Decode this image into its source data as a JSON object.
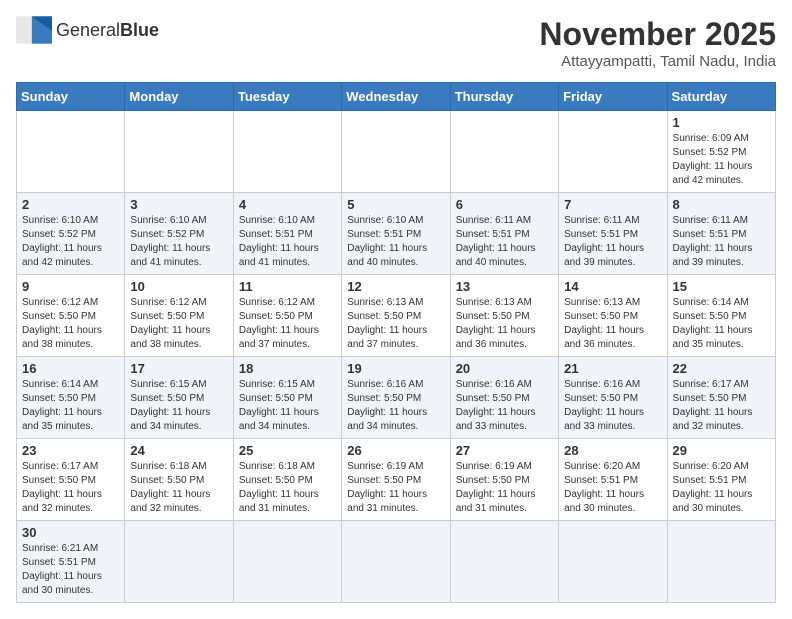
{
  "logo": {
    "text_general": "General",
    "text_blue": "Blue"
  },
  "title": "November 2025",
  "location": "Attayyampatti, Tamil Nadu, India",
  "weekdays": [
    "Sunday",
    "Monday",
    "Tuesday",
    "Wednesday",
    "Thursday",
    "Friday",
    "Saturday"
  ],
  "weeks": [
    [
      null,
      null,
      null,
      null,
      null,
      null,
      {
        "day": "1",
        "sunrise": "6:09 AM",
        "sunset": "5:52 PM",
        "daylight": "11 hours and 42 minutes."
      }
    ],
    [
      {
        "day": "2",
        "sunrise": "6:10 AM",
        "sunset": "5:52 PM",
        "daylight": "11 hours and 42 minutes."
      },
      {
        "day": "3",
        "sunrise": "6:10 AM",
        "sunset": "5:52 PM",
        "daylight": "11 hours and 41 minutes."
      },
      {
        "day": "4",
        "sunrise": "6:10 AM",
        "sunset": "5:51 PM",
        "daylight": "11 hours and 41 minutes."
      },
      {
        "day": "5",
        "sunrise": "6:10 AM",
        "sunset": "5:51 PM",
        "daylight": "11 hours and 40 minutes."
      },
      {
        "day": "6",
        "sunrise": "6:11 AM",
        "sunset": "5:51 PM",
        "daylight": "11 hours and 40 minutes."
      },
      {
        "day": "7",
        "sunrise": "6:11 AM",
        "sunset": "5:51 PM",
        "daylight": "11 hours and 39 minutes."
      },
      {
        "day": "8",
        "sunrise": "6:11 AM",
        "sunset": "5:51 PM",
        "daylight": "11 hours and 39 minutes."
      }
    ],
    [
      {
        "day": "9",
        "sunrise": "6:12 AM",
        "sunset": "5:50 PM",
        "daylight": "11 hours and 38 minutes."
      },
      {
        "day": "10",
        "sunrise": "6:12 AM",
        "sunset": "5:50 PM",
        "daylight": "11 hours and 38 minutes."
      },
      {
        "day": "11",
        "sunrise": "6:12 AM",
        "sunset": "5:50 PM",
        "daylight": "11 hours and 37 minutes."
      },
      {
        "day": "12",
        "sunrise": "6:13 AM",
        "sunset": "5:50 PM",
        "daylight": "11 hours and 37 minutes."
      },
      {
        "day": "13",
        "sunrise": "6:13 AM",
        "sunset": "5:50 PM",
        "daylight": "11 hours and 36 minutes."
      },
      {
        "day": "14",
        "sunrise": "6:13 AM",
        "sunset": "5:50 PM",
        "daylight": "11 hours and 36 minutes."
      },
      {
        "day": "15",
        "sunrise": "6:14 AM",
        "sunset": "5:50 PM",
        "daylight": "11 hours and 35 minutes."
      }
    ],
    [
      {
        "day": "16",
        "sunrise": "6:14 AM",
        "sunset": "5:50 PM",
        "daylight": "11 hours and 35 minutes."
      },
      {
        "day": "17",
        "sunrise": "6:15 AM",
        "sunset": "5:50 PM",
        "daylight": "11 hours and 34 minutes."
      },
      {
        "day": "18",
        "sunrise": "6:15 AM",
        "sunset": "5:50 PM",
        "daylight": "11 hours and 34 minutes."
      },
      {
        "day": "19",
        "sunrise": "6:16 AM",
        "sunset": "5:50 PM",
        "daylight": "11 hours and 34 minutes."
      },
      {
        "day": "20",
        "sunrise": "6:16 AM",
        "sunset": "5:50 PM",
        "daylight": "11 hours and 33 minutes."
      },
      {
        "day": "21",
        "sunrise": "6:16 AM",
        "sunset": "5:50 PM",
        "daylight": "11 hours and 33 minutes."
      },
      {
        "day": "22",
        "sunrise": "6:17 AM",
        "sunset": "5:50 PM",
        "daylight": "11 hours and 32 minutes."
      }
    ],
    [
      {
        "day": "23",
        "sunrise": "6:17 AM",
        "sunset": "5:50 PM",
        "daylight": "11 hours and 32 minutes."
      },
      {
        "day": "24",
        "sunrise": "6:18 AM",
        "sunset": "5:50 PM",
        "daylight": "11 hours and 32 minutes."
      },
      {
        "day": "25",
        "sunrise": "6:18 AM",
        "sunset": "5:50 PM",
        "daylight": "11 hours and 31 minutes."
      },
      {
        "day": "26",
        "sunrise": "6:19 AM",
        "sunset": "5:50 PM",
        "daylight": "11 hours and 31 minutes."
      },
      {
        "day": "27",
        "sunrise": "6:19 AM",
        "sunset": "5:50 PM",
        "daylight": "11 hours and 31 minutes."
      },
      {
        "day": "28",
        "sunrise": "6:20 AM",
        "sunset": "5:51 PM",
        "daylight": "11 hours and 30 minutes."
      },
      {
        "day": "29",
        "sunrise": "6:20 AM",
        "sunset": "5:51 PM",
        "daylight": "11 hours and 30 minutes."
      }
    ],
    [
      {
        "day": "30",
        "sunrise": "6:21 AM",
        "sunset": "5:51 PM",
        "daylight": "11 hours and 30 minutes."
      },
      null,
      null,
      null,
      null,
      null,
      null
    ]
  ],
  "labels": {
    "sunrise": "Sunrise:",
    "sunset": "Sunset:",
    "daylight": "Daylight:"
  }
}
